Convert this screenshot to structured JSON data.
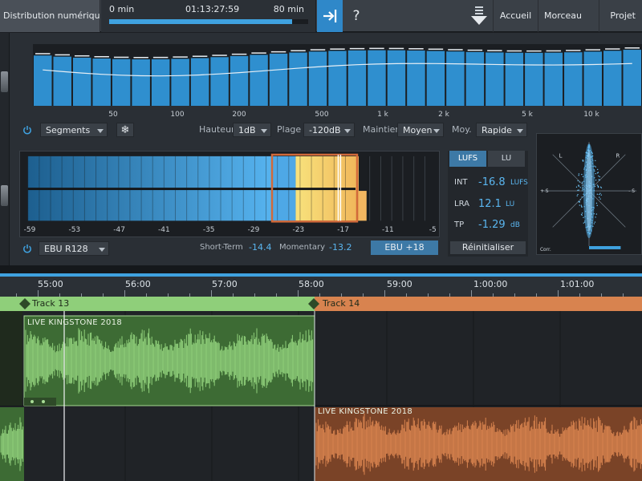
{
  "app": {
    "title": "Distribution numérique"
  },
  "transport": {
    "start_label": "0 min",
    "position_label": "01:13:27:59",
    "end_label": "80 min",
    "progress_fraction": 0.92
  },
  "toolbar": {
    "help_label": "?",
    "nav": [
      "Accueil",
      "Morceau",
      "Projet"
    ]
  },
  "spectrum": {
    "frequency_labels": [
      "50",
      "100",
      "200",
      "500",
      "1 k",
      "2 k",
      "5 k",
      "10 k"
    ],
    "mode_value": "Segments",
    "height_label": "Hauteur",
    "height_value": "1dB",
    "range_label": "Plage",
    "range_value": "-120dB",
    "hold_label": "Maintien",
    "hold_value": "Moyen",
    "avg_label": "Moy.",
    "avg_value": "Rapide"
  },
  "loudness": {
    "scale_labels": [
      "-59",
      "-53",
      "-47",
      "-41",
      "-35",
      "-29",
      "-23",
      "-17",
      "-11",
      "-5"
    ],
    "standard_value": "EBU R128",
    "short_term_label": "Short-Term",
    "short_term_value": "-14.4",
    "momentary_label": "Momentary",
    "momentary_value": "-13.2",
    "scale_button": "EBU +18"
  },
  "readout": {
    "tabs": [
      "LUFS",
      "LU"
    ],
    "active_tab": "LUFS",
    "rows": [
      {
        "key": "INT",
        "value": "-16.8",
        "unit": "LUFS"
      },
      {
        "key": "LRA",
        "value": "12.1",
        "unit": "LU"
      },
      {
        "key": "TP",
        "value": "-1.29",
        "unit": "dB"
      }
    ],
    "reset_label": "Réinitialiser"
  },
  "scope": {
    "left_label": "L",
    "right_label": "R",
    "plus_s_label": "+ S",
    "minus_s_label": "- S",
    "corr_label": "Corr."
  },
  "timeline": {
    "ruler_labels": [
      "55:00",
      "56:00",
      "57:00",
      "58:00",
      "59:00",
      "1:00:00",
      "1:01:00"
    ],
    "tracks": [
      {
        "name": "Track 13",
        "color": "#8fcf7a",
        "clip_title": "LIVE KINGSTONE 2018"
      },
      {
        "name": "Track 14",
        "color": "#d8834f",
        "clip_title": "LIVE KINGSTONE 2018"
      }
    ]
  },
  "colors": {
    "accent": "#3fa2e0",
    "meter_yellow": "#f5d05c",
    "clip_green": "#8fcf7a",
    "clip_orange": "#d8834f"
  }
}
